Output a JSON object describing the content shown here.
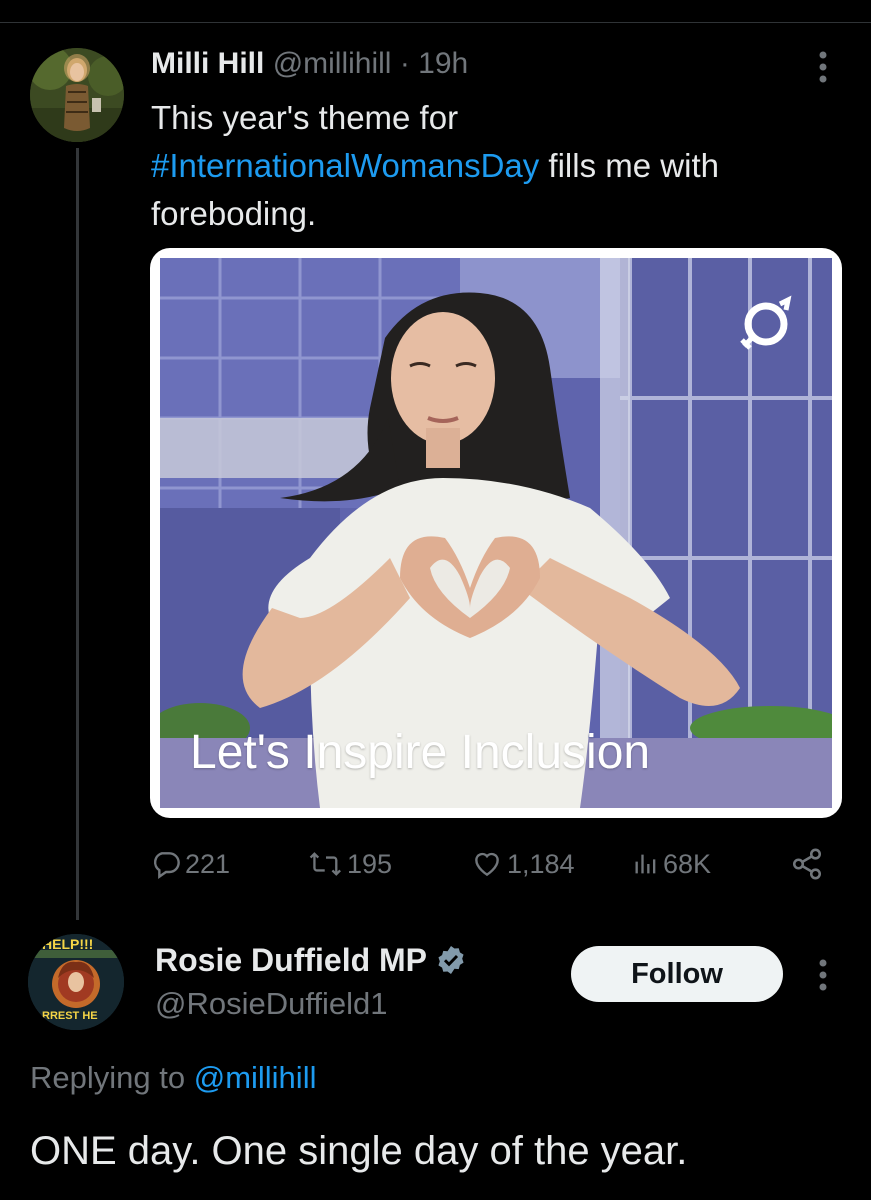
{
  "tweet": {
    "author_name": "Milli Hill",
    "handle": "@millihill",
    "separator": "·",
    "time": "19h",
    "text_part1": "This year's theme for",
    "hashtag": "#InternationalWomansDay",
    "text_part2": " fills me with foreboding.",
    "media": {
      "caption": "Let's Inspire Inclusion",
      "logo_icon": "iwd-venus-symbol-icon"
    },
    "stats": {
      "replies": "221",
      "reposts": "195",
      "likes": "1,184",
      "views": "68K"
    }
  },
  "reply": {
    "author_name": "Rosie Duffield MP",
    "verified_icon": "verified-badge-icon",
    "handle": "@RosieDuffield1",
    "follow_label": "Follow",
    "replying_prefix": "Replying to ",
    "replying_to": "@millihill",
    "text": "ONE day. One single day of the year.",
    "avatar_badge_top": "HELP!!!",
    "avatar_badge_bottom": "RREST HE"
  },
  "colors": {
    "background": "#000000",
    "text": "#e7e9ea",
    "muted": "#71767b",
    "link": "#1d9bf0",
    "verified": "#829aab"
  }
}
